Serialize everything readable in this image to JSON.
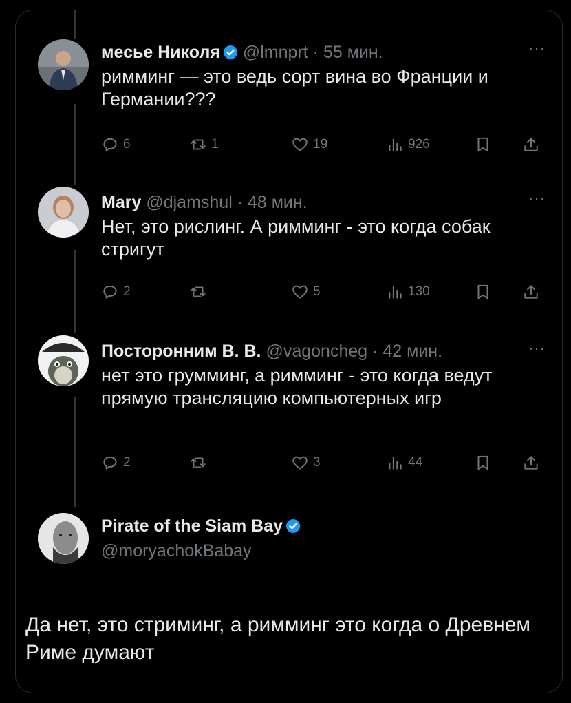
{
  "tweets": [
    {
      "name": "месье Николя",
      "verified": true,
      "handle": "@lmnprt",
      "time": "· 55 мин.",
      "text": "римминг — это ведь сорт вина во Франции и Германии???",
      "replies": "6",
      "retweets": "1",
      "likes": "19",
      "views": "926"
    },
    {
      "name": "Mary",
      "verified": false,
      "handle": "@djamshul",
      "time": "· 48 мин.",
      "text": "Нет, это рислинг. А римминг - это когда собак стригут",
      "replies": "2",
      "retweets": "",
      "likes": "5",
      "views": "130"
    },
    {
      "name": "Посторонним В. В.",
      "verified": false,
      "handle": "@vagoncheg",
      "time": "· 42 мин.",
      "text": "нет это грумминг, а римминг - это когда ведут прямую трансляцию компьютерных игр",
      "replies": "2",
      "retweets": "",
      "likes": "3",
      "views": "44"
    }
  ],
  "main": {
    "name": "Pirate of the Siam Bay",
    "verified": true,
    "handle": "@moryachokBabay",
    "text": "Да нет, это стриминг, а римминг это когда о Древнем Риме думают"
  },
  "more_label": "···",
  "colors": {
    "background": "#000000",
    "text": "#e7e9ea",
    "muted": "#71767b",
    "verified": "#1d9bf0",
    "line": "#333639"
  }
}
